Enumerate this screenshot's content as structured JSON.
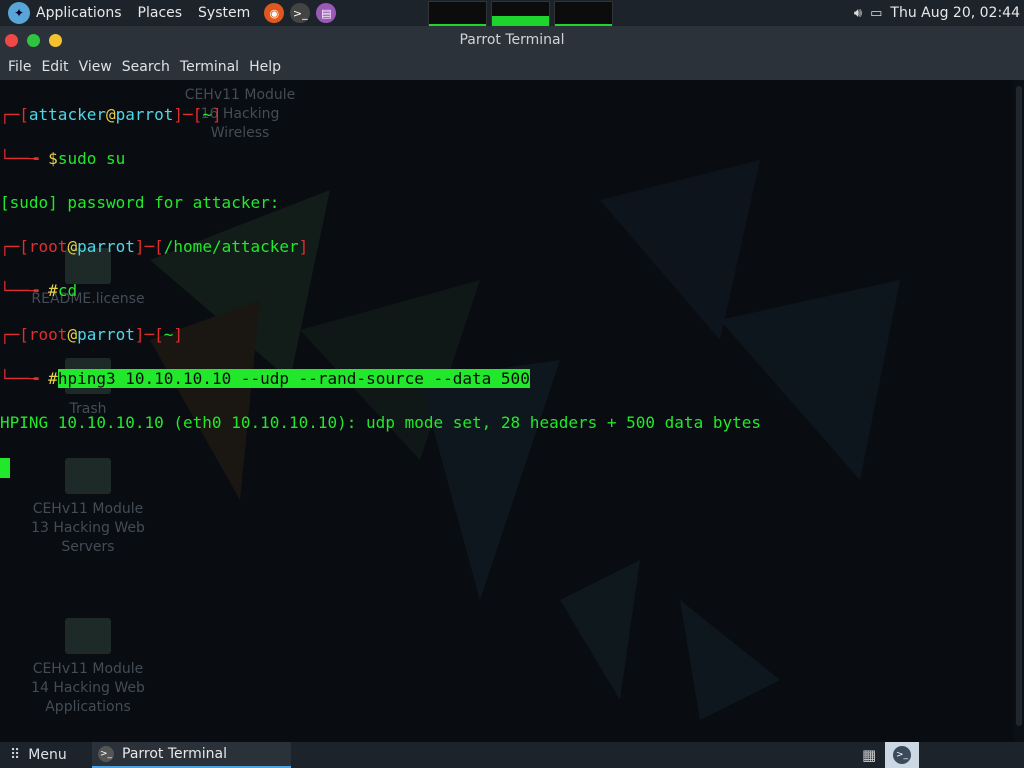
{
  "top_panel": {
    "menus": [
      "Applications",
      "Places",
      "System"
    ],
    "clock": "Thu Aug 20, 02:44",
    "icons": [
      "parrot-logo-icon",
      "firefox-icon",
      "terminal-icon",
      "notes-icon",
      "volume-icon",
      "screen-icon"
    ],
    "monitor_levels": [
      0.1,
      0.4,
      0.1
    ]
  },
  "window": {
    "title": "Parrot Terminal",
    "menu": [
      "File",
      "Edit",
      "View",
      "Search",
      "Terminal",
      "Help"
    ]
  },
  "terminal": {
    "l1_user": "attacker",
    "l1_at": "@",
    "l1_host": "parrot",
    "l1_dir": "~",
    "l2_prompt": "$",
    "l2_cmd": "sudo su",
    "l3": "[sudo] password for attacker:",
    "l4_user": "root",
    "l4_at": "@",
    "l4_host": "parrot",
    "l4_dir": "/home/attacker",
    "l5_prompt": "#",
    "l5_cmd": "cd",
    "l6_user": "root",
    "l6_at": "@",
    "l6_host": "parrot",
    "l6_dir": "~",
    "l7_prompt": "#",
    "l7_cmd": "hping3 10.10.10.10 --udp --rand-source --data 500",
    "l8": "HPING 10.10.10.10 (eth0 10.10.10.10): udp mode set, 28 headers + 500 data bytes"
  },
  "desktop_icons": [
    {
      "label": "CEHv11 Module 16 Hacking Wireless"
    },
    {
      "label": "README.license"
    },
    {
      "label": "Trash"
    },
    {
      "label": "CEHv11 Module 13 Hacking Web Servers"
    },
    {
      "label": "CEHv11 Module 14 Hacking Web Applications"
    }
  ],
  "taskbar": {
    "menu_label": "Menu",
    "task_label": "Parrot Terminal"
  },
  "colors": {
    "prompt_red": "#e12d2d",
    "host_cyan": "#4fd8e8",
    "at_yellow": "#e8d24a",
    "text_green": "#22e82b"
  }
}
